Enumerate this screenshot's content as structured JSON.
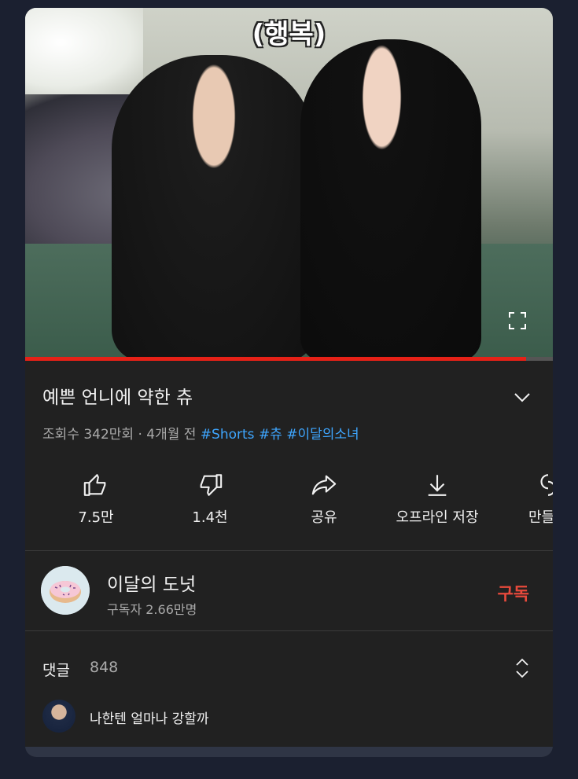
{
  "video": {
    "caption": "(행복)",
    "progress": 0.95
  },
  "info": {
    "title": "예쁜 언니에 약한 츄",
    "views": "조회수 342만회 · 4개월 전",
    "tags": [
      "#Shorts",
      "#츄",
      "#이달의소녀"
    ]
  },
  "actions": {
    "like": "7.5만",
    "dislike": "1.4천",
    "share": "공유",
    "download": "오프라인 저장",
    "remix": "만들"
  },
  "channel": {
    "name": "이달의 도넛",
    "subscribers": "구독자 2.66만명",
    "subscribe_label": "구독"
  },
  "comments": {
    "title": "댓글",
    "count": "848",
    "first_comment": "나한텐 얼마나 강할까"
  },
  "colors": {
    "accent": "#e62117",
    "link": "#3ea6ff",
    "subscribe": "#e84a3c",
    "background": "#212121"
  }
}
